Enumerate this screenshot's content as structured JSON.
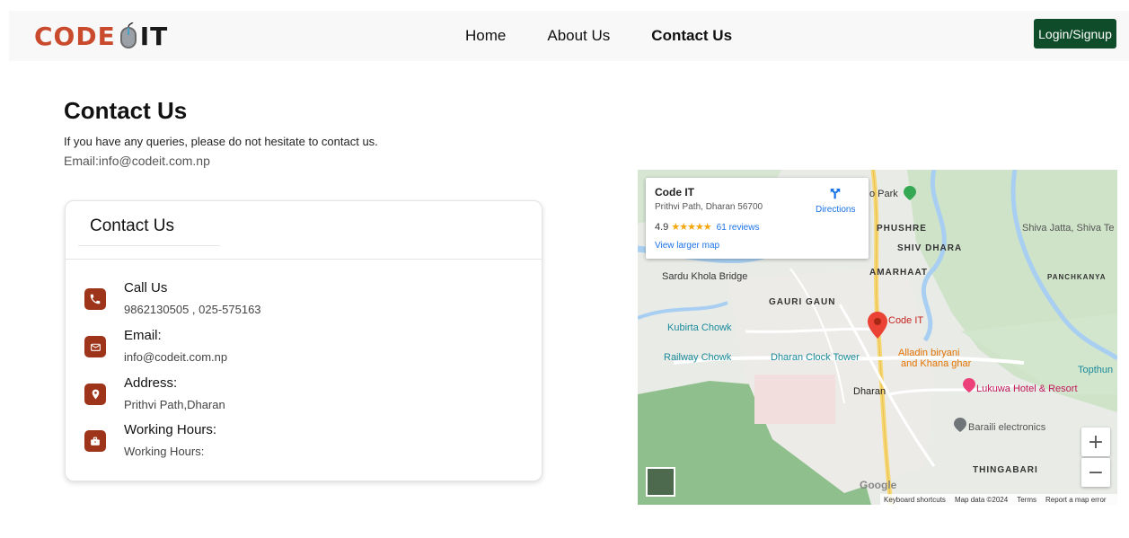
{
  "brand": {
    "code": "CODE",
    "it": "IT"
  },
  "nav": {
    "home": "Home",
    "about": "About Us",
    "contact": "Contact Us",
    "login": "Login/Signup"
  },
  "header": {
    "title": "Contact Us",
    "intro": "If you have any queries, please do not hesitate to contact us.",
    "email_prefix": "Email:",
    "email": "info@codeit.com.np"
  },
  "card": {
    "title": "Contact Us",
    "items": [
      {
        "label": "Call Us",
        "value": "9862130505 , 025-575163",
        "icon": "phone-icon"
      },
      {
        "label": "Email:",
        "value": "info@codeit.com.np",
        "icon": "mail-icon"
      },
      {
        "label": "Address:",
        "value": "Prithvi Path,Dharan",
        "icon": "location-icon"
      },
      {
        "label": "Working Hours:",
        "value": "Working Hours:",
        "icon": "briefcase-icon"
      }
    ]
  },
  "map": {
    "place_name": "Code IT",
    "place_address": "Prithvi Path, Dharan 56700",
    "rating": "4.9",
    "stars": "★★★★★",
    "reviews": "61 reviews",
    "larger_map": "View larger map",
    "directions": "Directions",
    "zoom_in": "+",
    "zoom_out": "−",
    "google": "Google",
    "attribution": [
      "Keyboard shortcuts",
      "Map data ©2024",
      "Terms",
      "Report a map error"
    ],
    "labels": {
      "park": "o Park",
      "phushre": "PHUSHRE",
      "shiv_dhara": "SHIV DHARA",
      "amarhaat": "AMARHAAT",
      "sardu": "Sardu Khola Bridge",
      "gauri_gaun": "GAURI GAUN",
      "kubirta": "Kubirta Chowk",
      "railway": "Railway Chowk",
      "clock_tower": "Dharan Clock Tower",
      "code_it_pin": "Code IT",
      "alladin1": "Alladin biryani",
      "alladin2": "and Khana ghar",
      "dharan": "Dharan",
      "lukuwa": "Lukuwa Hotel & Resort",
      "baraili": "Baraili electronics",
      "thingabari": "THINGABARI",
      "shiva_jatta": "Shiva Jatta, Shiva Te",
      "panchkanya": "PANCHKANYA",
      "topthun": "Topthun"
    }
  },
  "colors": {
    "accent": "#9e3419",
    "login_bg": "#0f4d2a",
    "brand_red": "#c94a2c"
  }
}
